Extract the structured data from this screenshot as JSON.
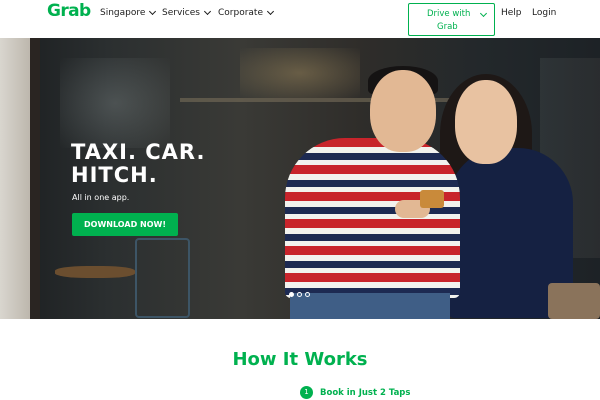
{
  "header": {
    "logo": "Grab",
    "nav": [
      {
        "label": "Singapore"
      },
      {
        "label": "Services"
      },
      {
        "label": "Corporate"
      }
    ],
    "drive_button": {
      "line1": "Drive with",
      "line2": "Grab"
    },
    "help": "Help",
    "login": "Login"
  },
  "hero": {
    "title": "TAXI. CAR.\nHITCH.",
    "subtitle": "All in one app.",
    "cta": "DOWNLOAD NOW!",
    "carousel": {
      "count": 3,
      "active_index": 0
    }
  },
  "how_it_works": {
    "title": "How It Works",
    "steps": [
      {
        "number": "1",
        "label": "Book in Just 2 Taps"
      }
    ]
  },
  "colors": {
    "brand_green": "#00b14f",
    "text_dark": "#1c1c1c"
  }
}
